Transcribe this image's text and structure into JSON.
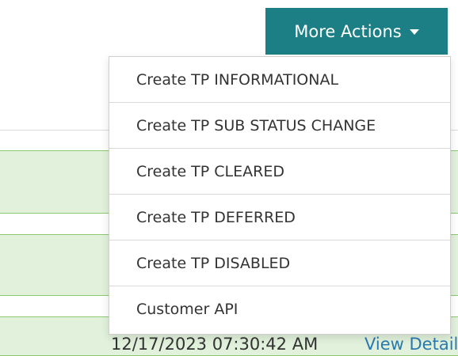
{
  "toolbar": {
    "more_actions_label": "More Actions"
  },
  "menu": {
    "items": [
      {
        "label": "Create TP INFORMATIONAL"
      },
      {
        "label": "Create TP SUB STATUS CHANGE"
      },
      {
        "label": "Create TP CLEARED"
      },
      {
        "label": "Create TP DEFERRED"
      },
      {
        "label": "Create TP DISABLED"
      },
      {
        "label": "Customer API"
      }
    ]
  },
  "background": {
    "timestamp_partial": "12/17/2023 07:30:42 AM",
    "view_details_partial": "View Details"
  },
  "colors": {
    "button_bg": "#1b7f85",
    "row_bg": "#e1f1db",
    "row_border": "#8cc870",
    "link": "#2a7ab0"
  }
}
